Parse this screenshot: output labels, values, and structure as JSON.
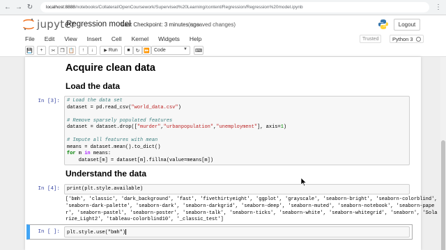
{
  "browser": {
    "tab_title": "Regression model",
    "url_host": "localhost:8888",
    "url_path": "/notebooks/Collateral/OpenCoursework/Supervised%20Learning/content/Regression/Regression%20model.ipynb"
  },
  "header": {
    "logo_text": "jupyter",
    "notebook_title": "Regression model",
    "checkpoint": "Last Checkpoint: 3 minutes ago",
    "unsaved": "(unsaved changes)",
    "logout_label": "Logout"
  },
  "menubar": {
    "items": [
      "File",
      "Edit",
      "View",
      "Insert",
      "Cell",
      "Kernel",
      "Widgets",
      "Help"
    ],
    "trusted_label": "Trusted",
    "kernel_label": "Python 3"
  },
  "toolbar": {
    "run_label": "Run",
    "cell_type": "Code"
  },
  "notebook": {
    "heading_acquire": "Acquire clean data",
    "heading_load": "Load the data",
    "heading_understand": "Understand the data",
    "cell3": {
      "prompt": "In [3]:",
      "lines": [
        "# Load the data set",
        "dataset = pd.read_csv(\"world_data.csv\")",
        "",
        "# Remove sparsely populated features",
        "dataset = dataset.drop([\"murder\",\"urbanpopulation\",\"unemployment\"], axis=1)",
        "",
        "# Impute all features with mean",
        "means = dataset.mean().to_dict()",
        "for m in means:",
        "    dataset[m] = dataset[m].fillna(value=means[m])"
      ]
    },
    "cell4": {
      "prompt": "In [4]:",
      "code": "print(plt.style.available)",
      "output_lines": [
        "['bmh', 'classic', 'dark_background', 'fast', 'fivethirtyeight', 'ggplot', 'grayscale', 'seaborn-bright', 'seaborn-colorblind',",
        "'seaborn-dark-palette', 'seaborn-dark', 'seaborn-darkgrid', 'seaborn-deep', 'seaborn-muted', 'seaborn-notebook', 'seaborn-pape",
        "r', 'seaborn-pastel', 'seaborn-poster', 'seaborn-talk', 'seaborn-ticks', 'seaborn-white', 'seaborn-whitegrid', 'seaborn', 'Sola",
        "rize_Light2', 'tableau-colorblind10', '_classic_test']"
      ]
    },
    "cell5": {
      "prompt": "In [ ]:",
      "code": "plt.style.use(\"bmh\")"
    }
  },
  "colors": {
    "prompt_in": "#303F9F",
    "active_cell_border": "#42A5F5",
    "comment": "#408080",
    "string": "#BA2121",
    "keyword": "#008000"
  }
}
